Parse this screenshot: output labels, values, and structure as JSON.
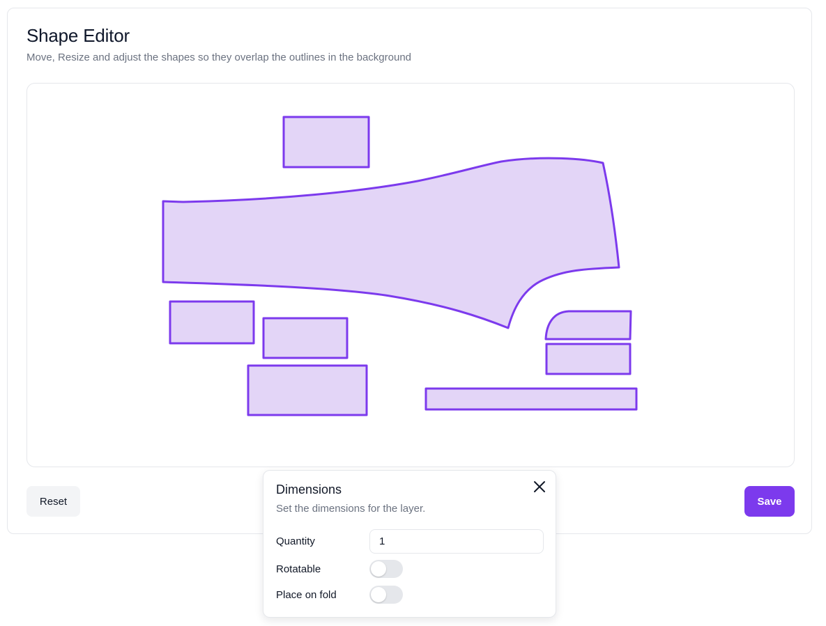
{
  "editor": {
    "title": "Shape Editor",
    "subtitle": "Move, Resize and adjust the shapes so they overlap the outlines in the background"
  },
  "canvas": {
    "shape_fill_color": "#e3d5f7",
    "shape_stroke_color": "#7c3aed",
    "shape_count": 9
  },
  "actions": {
    "reset_label": "Reset",
    "save_label": "Save",
    "save_color": "#7c3aed"
  },
  "dimensions_popover": {
    "title": "Dimensions",
    "description": "Set the dimensions for the layer.",
    "close_icon": "close-icon",
    "quantity_label": "Quantity",
    "quantity_value": "1",
    "rotatable_label": "Rotatable",
    "rotatable_on": false,
    "place_on_fold_label": "Place on fold",
    "place_on_fold_on": false
  }
}
